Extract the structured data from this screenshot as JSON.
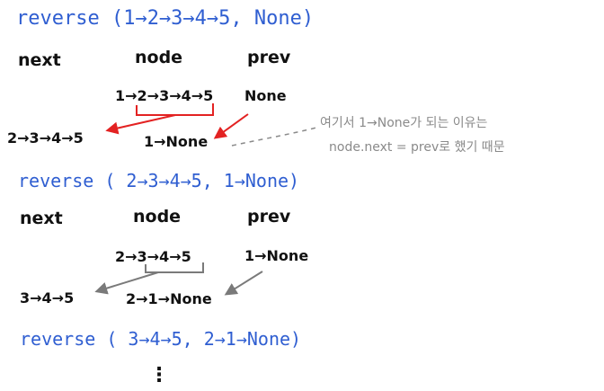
{
  "colors": {
    "call": "#2f5ed1",
    "ink": "#111111",
    "red_arrow": "#e32222",
    "gray_arrow": "#7a7a7a",
    "note": "#8a8a8a"
  },
  "steps": [
    {
      "call": "reverse (1→2→3→4→5, None)",
      "headers": {
        "next": "next",
        "node": "node",
        "prev": "prev"
      },
      "node_list": "1→2→3→4→5",
      "prev_value": "None",
      "result_next": "2→3→4→5",
      "result_node": "1→None"
    },
    {
      "call": "reverse ( 2→3→4→5, 1→None)",
      "headers": {
        "next": "next",
        "node": "node",
        "prev": "prev"
      },
      "node_list": "2→3→4→5",
      "prev_value": "1→None",
      "result_next": "3→4→5",
      "result_node": "2→1→None"
    },
    {
      "call": "reverse ( 3→4→5, 2→1→None)"
    }
  ],
  "note": {
    "line1": "여기서 1→None가 되는 이유는",
    "line2": "node.next = prev로 했기 때문"
  },
  "continuation": "⋮"
}
